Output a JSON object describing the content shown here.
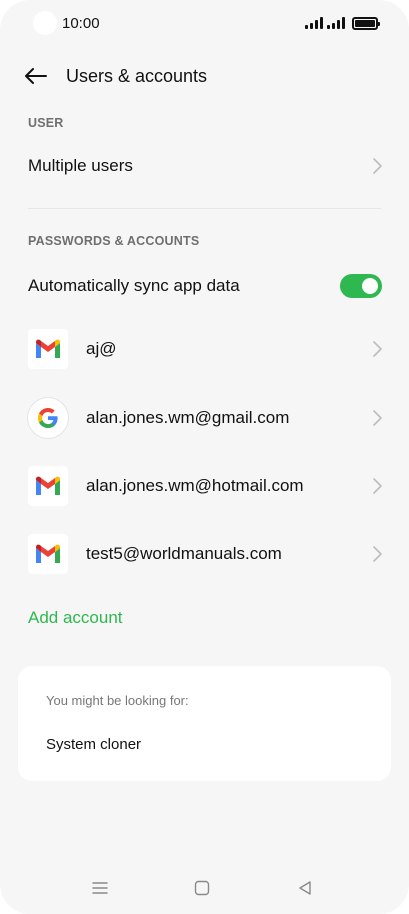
{
  "status_bar": {
    "time": "10:00"
  },
  "header": {
    "title": "Users & accounts"
  },
  "sections": {
    "user": {
      "label": "USER",
      "multiple_users": "Multiple users"
    },
    "passwords": {
      "label": "PASSWORDS & ACCOUNTS",
      "auto_sync": {
        "label": "Automatically sync app data",
        "enabled": true
      }
    }
  },
  "accounts": [
    {
      "label": "aj@",
      "icon": "gmail-icon"
    },
    {
      "label": "alan.jones.wm@gmail.com",
      "icon": "google-icon"
    },
    {
      "label": "alan.jones.wm@hotmail.com",
      "icon": "gmail-icon"
    },
    {
      "label": "test5@worldmanuals.com",
      "icon": "gmail-icon"
    }
  ],
  "add_account": "Add account",
  "suggestions": {
    "title": "You might be looking for:",
    "items": [
      "System cloner"
    ]
  },
  "colors": {
    "accent": "#2fb84f",
    "background": "#f6f6f6"
  }
}
